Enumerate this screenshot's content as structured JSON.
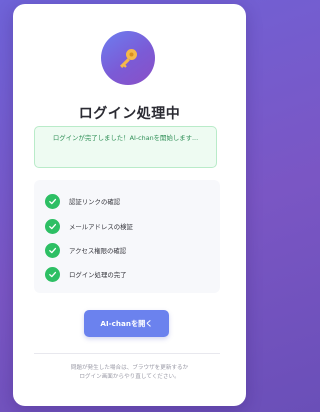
{
  "card": {
    "title": "ログイン処理中",
    "notice": "ログインが完了しました！AI-chanを開始します..."
  },
  "steps": [
    {
      "label": "認証リンクの確認",
      "status": "done"
    },
    {
      "label": "メールアドレスの検証",
      "status": "done"
    },
    {
      "label": "アクセス権限の確認",
      "status": "done"
    },
    {
      "label": "ログイン処理の完了",
      "status": "done"
    }
  ],
  "button": {
    "label": "AI-chanを開く"
  },
  "footer": {
    "line1": "問題が発生した場合は、ブラウザを更新するか",
    "line2": "ログイン画面からやり直してください。"
  },
  "icons": {
    "header": "key-icon",
    "step": "checkmark-icon"
  },
  "colors": {
    "accent": "#6b82ee",
    "success": "#2dbf64",
    "background": "#7a56c4"
  }
}
